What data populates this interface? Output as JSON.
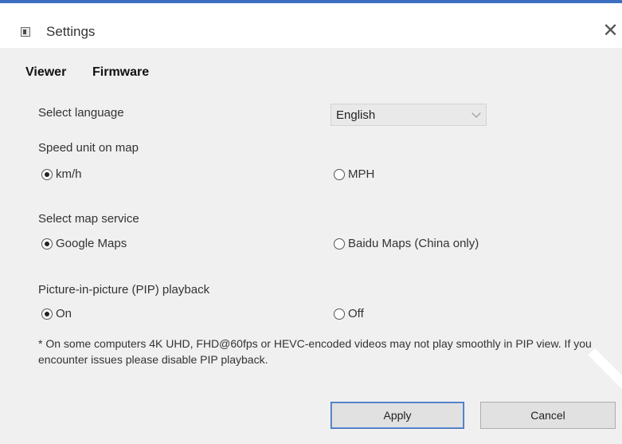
{
  "window": {
    "title": "Settings",
    "close_glyph": "✕"
  },
  "tabs": [
    {
      "label": "Viewer",
      "active": true
    },
    {
      "label": "Firmware",
      "active": false
    }
  ],
  "language": {
    "label": "Select language",
    "selected": "English"
  },
  "speed_unit": {
    "label": "Speed unit on map",
    "options": [
      {
        "label": "km/h",
        "checked": true
      },
      {
        "label": "MPH",
        "checked": false
      }
    ]
  },
  "map_service": {
    "label": "Select map service",
    "options": [
      {
        "label": "Google Maps",
        "checked": true
      },
      {
        "label": "Baidu Maps (China only)",
        "checked": false
      }
    ]
  },
  "pip": {
    "label": "Picture-in-picture (PIP) playback",
    "options": [
      {
        "label": "On",
        "checked": true
      },
      {
        "label": "Off",
        "checked": false
      }
    ],
    "note": "* On some computers 4K UHD, FHD@60fps or HEVC-encoded videos may not play smoothly in PIP view. If you encounter issues please disable PIP playback."
  },
  "buttons": {
    "apply": "Apply",
    "cancel": "Cancel"
  },
  "colors": {
    "accent": "#3c6fbf",
    "background": "#f0f0f0"
  },
  "icons": {
    "app": "settings-app-icon",
    "close": "close-icon",
    "dropdown": "chevron-down-icon"
  }
}
